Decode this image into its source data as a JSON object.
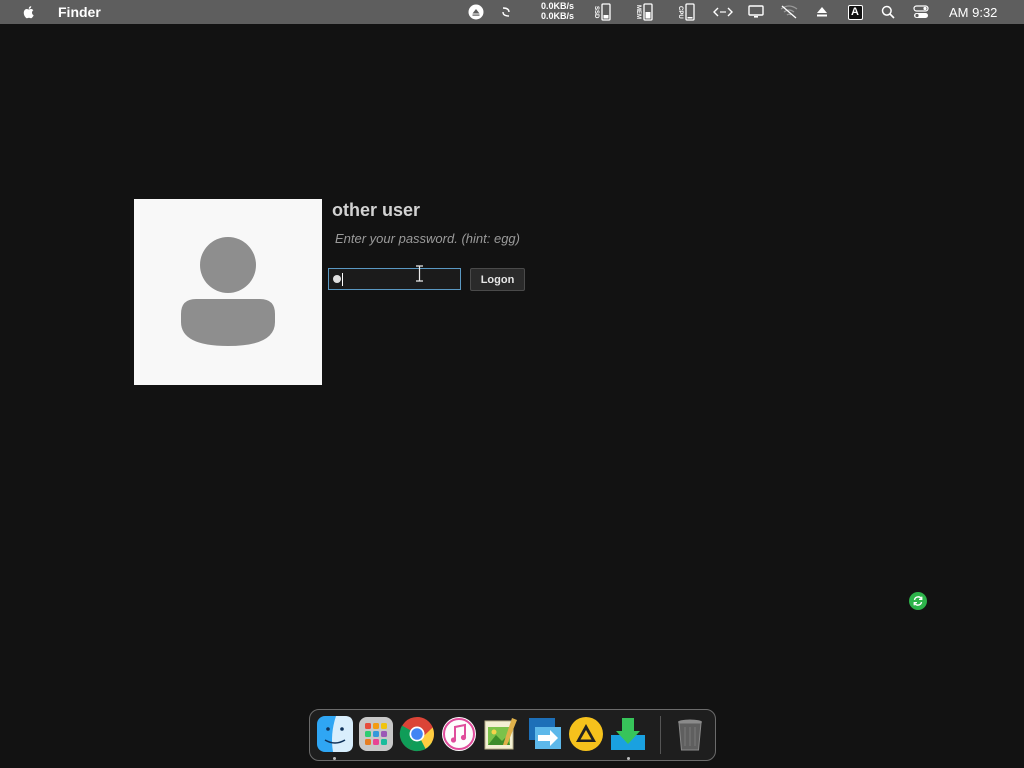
{
  "menubar": {
    "app_name": "Finder",
    "network_up": "0.0KB/s",
    "network_down": "0.0KB/s",
    "ssd_label": "SSD",
    "mem_label": "MEM",
    "cpu_label": "CPU",
    "clock": "AM 9:32",
    "input_source": "A"
  },
  "login": {
    "user_name": "other user",
    "hint": "Enter your password. (hint: egg)",
    "logon_label": "Logon"
  },
  "dock": {
    "apps": [
      "finder-icon",
      "launchpad-icon",
      "chrome-icon",
      "itunes-icon",
      "image-editor-icon",
      "migration-icon",
      "artstudio-icon",
      "downloader-icon",
      "trash-icon"
    ]
  },
  "colors": {
    "menubar_bg": "#5e5e5e",
    "desktop_bg": "#121212",
    "input_border": "#5a98c2",
    "sync_green": "#2db34a"
  }
}
